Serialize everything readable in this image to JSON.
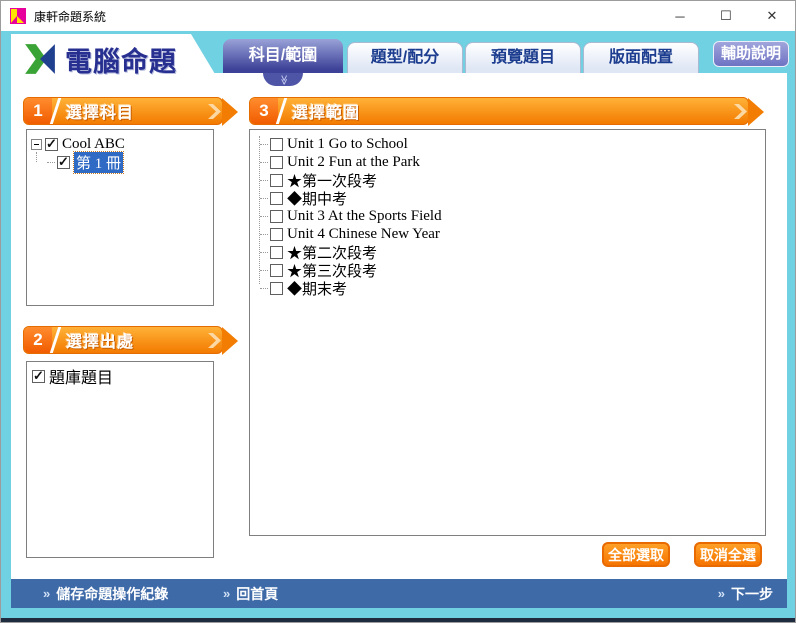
{
  "window": {
    "title": "康軒命題系統",
    "minimize_glyph": "─",
    "maximize_glyph": "☐",
    "close_glyph": "✕"
  },
  "header": {
    "app_title": "電腦命題",
    "tabs": [
      {
        "label": "科目/範圍",
        "active": true
      },
      {
        "label": "題型/配分",
        "active": false
      },
      {
        "label": "預覽題目",
        "active": false
      },
      {
        "label": "版面配置",
        "active": false
      }
    ],
    "active_tab_marker": "≫",
    "help_button_label": "輔助說明"
  },
  "colors": {
    "frame_cyan": "#6fd1e2",
    "banner_orange": "#f37a00",
    "active_tab_purple": "#3d4198",
    "selection_blue": "#2f6ac4",
    "footer_blue": "#3e6aa8"
  },
  "section_subject": {
    "number": "1",
    "title": "選擇科目"
  },
  "section_source": {
    "number": "2",
    "title": "選擇出處"
  },
  "section_range": {
    "number": "3",
    "title": "選擇範圍"
  },
  "subject_tree": {
    "root": {
      "label": "Cool ABC",
      "checked": true
    },
    "child": {
      "label": "第 1 冊",
      "checked": true,
      "selected": true
    }
  },
  "source_items": [
    {
      "label": "題庫題目",
      "checked": true
    }
  ],
  "range_items": [
    {
      "label": "Unit 1 Go to School",
      "checked": false
    },
    {
      "label": "Unit 2 Fun at the Park",
      "checked": false
    },
    {
      "label": "★第一次段考",
      "checked": false
    },
    {
      "label": "◆期中考",
      "checked": false
    },
    {
      "label": "Unit 3 At the Sports Field",
      "checked": false
    },
    {
      "label": "Unit 4 Chinese New Year",
      "checked": false
    },
    {
      "label": "★第二次段考",
      "checked": false
    },
    {
      "label": "★第三次段考",
      "checked": false
    },
    {
      "label": "◆期末考",
      "checked": false
    }
  ],
  "range_buttons": {
    "select_all": "全部選取",
    "deselect_all": "取消全選"
  },
  "footer": {
    "arrow": "»",
    "save_label": "儲存命題操作紀錄",
    "home_label": "回首頁",
    "next_label": "下一步"
  }
}
